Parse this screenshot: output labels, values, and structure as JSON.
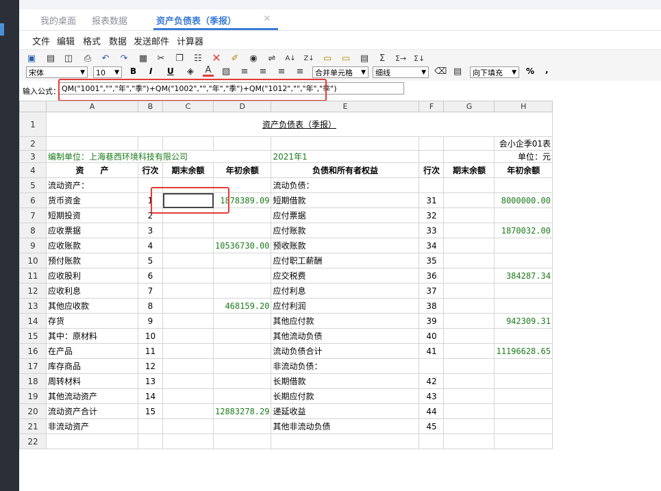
{
  "tabs": [
    {
      "label": "我的桌面",
      "active": false
    },
    {
      "label": "报表数据",
      "active": false
    },
    {
      "label": "资产负债表（季报）",
      "active": true
    }
  ],
  "tab_close": "×",
  "menu": [
    "文件",
    "编辑",
    "格式",
    "数据",
    "发送邮件",
    "计算器"
  ],
  "toolbar": {
    "font_name": "宋体",
    "font_size": "10",
    "bold": "B",
    "italic": "I",
    "underline": "U",
    "merge": "合并单元格",
    "border": "细线",
    "fill": "向下填充",
    "percent": "%",
    "comma": ","
  },
  "formula": {
    "label": "输入公式：",
    "value": "QM(\"1001\",\"\",\"年\",\"季\")+QM(\"1002\",\"\",\"年\",\"季\")+QM(\"1012\",\"\",\"年\",\"季\")"
  },
  "columns": [
    "A",
    "B",
    "C",
    "D",
    "E",
    "F",
    "G",
    "H"
  ],
  "sheet": {
    "title": "资产负债表（季报）",
    "form_code": "会小企季01表",
    "company": "编制单位：上海巷西环境科技有限公司",
    "period": "2021年1",
    "unit": "单位：元",
    "headers": [
      "资　　产",
      "行次",
      "期末余额",
      "年初余额",
      "负债和所有者权益",
      "行次",
      "期末余额",
      "年初余额"
    ]
  },
  "rows": [
    {
      "n": "5",
      "a": "流动资产：",
      "b": "",
      "c": "",
      "d": "",
      "e": "流动负债：",
      "f": "",
      "g": "",
      "h": ""
    },
    {
      "n": "6",
      "a": "货币资金",
      "b": "1",
      "c": "",
      "d": "1878389.09",
      "e": "短期借款",
      "f": "31",
      "g": "",
      "h": "8000000.00"
    },
    {
      "n": "7",
      "a": "短期投资",
      "b": "2",
      "c": "",
      "d": "",
      "e": "应付票据",
      "f": "32",
      "g": "",
      "h": ""
    },
    {
      "n": "8",
      "a": "应收票据",
      "b": "3",
      "c": "",
      "d": "",
      "e": "应付账款",
      "f": "33",
      "g": "",
      "h": "1870032.00"
    },
    {
      "n": "9",
      "a": "应收账款",
      "b": "4",
      "c": "",
      "d": "10536730.00",
      "e": "预收账款",
      "f": "34",
      "g": "",
      "h": ""
    },
    {
      "n": "10",
      "a": "预付账款",
      "b": "5",
      "c": "",
      "d": "",
      "e": "应付职工薪酬",
      "f": "35",
      "g": "",
      "h": ""
    },
    {
      "n": "11",
      "a": "应收股利",
      "b": "6",
      "c": "",
      "d": "",
      "e": "应交税费",
      "f": "36",
      "g": "",
      "h": "384287.34"
    },
    {
      "n": "12",
      "a": "应收利息",
      "b": "7",
      "c": "",
      "d": "",
      "e": "应付利息",
      "f": "37",
      "g": "",
      "h": ""
    },
    {
      "n": "13",
      "a": "其他应收款",
      "b": "8",
      "c": "",
      "d": "468159.20",
      "e": "应付利润",
      "f": "38",
      "g": "",
      "h": ""
    },
    {
      "n": "14",
      "a": "存货",
      "b": "9",
      "c": "",
      "d": "",
      "e": "其他应付款",
      "f": "39",
      "g": "",
      "h": "942309.31"
    },
    {
      "n": "15",
      "a": "其中：原材料",
      "b": "10",
      "c": "",
      "d": "",
      "e": "其他流动负债",
      "f": "40",
      "g": "",
      "h": ""
    },
    {
      "n": "16",
      "a": "在产品",
      "b": "11",
      "c": "",
      "d": "",
      "e": "流动负债合计",
      "f": "41",
      "g": "",
      "h": "11196628.65"
    },
    {
      "n": "17",
      "a": "库存商品",
      "b": "12",
      "c": "",
      "d": "",
      "e": "非流动负债：",
      "f": "",
      "g": "",
      "h": ""
    },
    {
      "n": "18",
      "a": "周转材料",
      "b": "13",
      "c": "",
      "d": "",
      "e": "长期借款",
      "f": "42",
      "g": "",
      "h": ""
    },
    {
      "n": "19",
      "a": "其他流动资产",
      "b": "14",
      "c": "",
      "d": "",
      "e": "长期应付款",
      "f": "43",
      "g": "",
      "h": ""
    },
    {
      "n": "20",
      "a": "流动资产合计",
      "b": "15",
      "c": "",
      "d": "12883278.29",
      "e": "递延收益",
      "f": "44",
      "g": "",
      "h": ""
    },
    {
      "n": "21",
      "a": "非流动资产",
      "b": "",
      "c": "",
      "d": "",
      "e": "其他非流动负债",
      "f": "45",
      "g": "",
      "h": ""
    },
    {
      "n": "22",
      "a": "",
      "b": "",
      "c": "",
      "d": "",
      "e": "",
      "f": "",
      "g": "",
      "h": ""
    }
  ]
}
